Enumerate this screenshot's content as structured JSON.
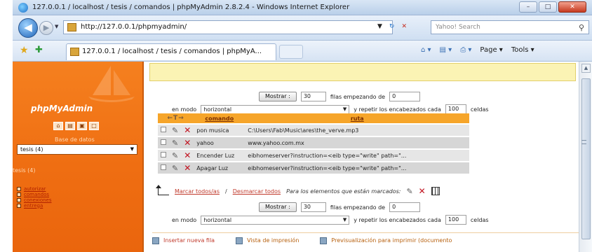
{
  "window": {
    "title": "127.0.0.1 / localhost / tesis / comandos | phpMyAdmin 2.8.2.4 - Windows Internet Explorer",
    "buttons": {
      "minimize": "–",
      "maximize": "□",
      "close": "✕"
    }
  },
  "nav": {
    "address": "http://127.0.0.1/phpmyadmin/",
    "search_placeholder": "Yahoo! Search"
  },
  "tabbar": {
    "tab_title": "127.0.0.1 / localhost / tesis / comandos | phpMyA...",
    "commands": {
      "page": "Page",
      "tools": "Tools"
    }
  },
  "sidebar": {
    "logo": "phpMyAdmin",
    "db_label": "Base de datos",
    "db_selected": "tesis (4)",
    "db_current": "tesis (4)",
    "tables": [
      "autorizar",
      "comandos",
      "conexiones",
      "entrega"
    ]
  },
  "main": {
    "notice": "",
    "controls": {
      "show_button": "Mostrar :",
      "rows_value": "30",
      "rows_text": "filas empezando de",
      "start_value": "0",
      "mode_label": "en modo",
      "mode_value": "horizontal",
      "repeat_text": "y repetir los encabezados cada",
      "repeat_value": "100",
      "cells_text": "celdas"
    },
    "table": {
      "arrows": "←T→",
      "columns": [
        "comando",
        "ruta"
      ],
      "rows": [
        {
          "comando": "pon musica",
          "ruta": "C:\\Users\\Fab\\Music\\ares\\the_verve.mp3"
        },
        {
          "comando": "yahoo",
          "ruta": "www.yahoo.com.mx"
        },
        {
          "comando": "Encender Luz",
          "ruta": "eibhomeserver?instruction=<eib type=\"write\" path=\"..."
        },
        {
          "comando": "Apagar Luz",
          "ruta": "eibhomeserver?instruction=<eib type=\"write\" path=\"..."
        }
      ]
    },
    "mark": {
      "mark_all": "Marcar todos/as",
      "separator": "/",
      "unmark_all": "Desmarcar todos",
      "marked_text": "Para los elementos que están marcados:"
    },
    "footer": {
      "insert": "Insertar nueva fila",
      "print_view": "Vista de impresión",
      "print_preview": "Previsualización para imprimir (documento"
    }
  }
}
